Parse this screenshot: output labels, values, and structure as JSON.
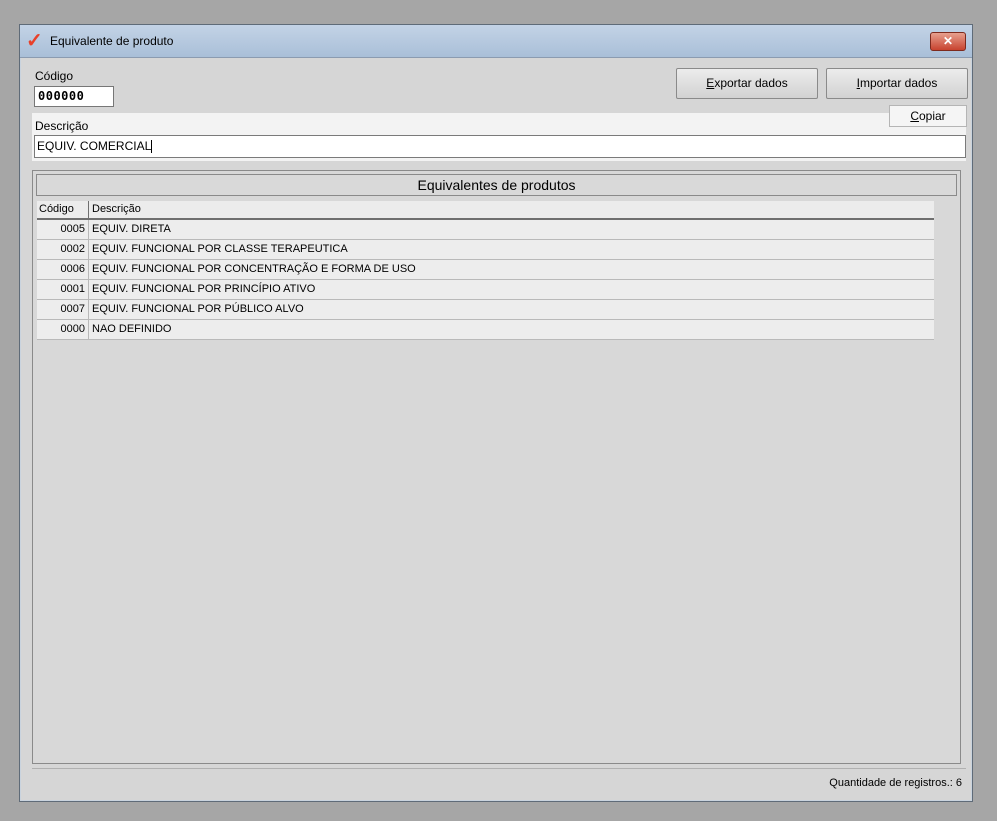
{
  "window": {
    "title": "Equivalente de produto",
    "close_label": "✕"
  },
  "form": {
    "code_label": "Código",
    "code_value": "000000",
    "description_label": "Descrição",
    "description_value": "EQUIV. COMERCIAL"
  },
  "toolbar": {
    "export_label_first": "E",
    "export_label_rest": "xportar dados",
    "import_label_first": "I",
    "import_label_rest": "mportar dados",
    "copy_label_first": "C",
    "copy_label_rest": "opiar"
  },
  "group": {
    "title": "Equivalentes de produtos"
  },
  "table": {
    "columns": [
      "Código",
      "Descrição"
    ],
    "rows": [
      {
        "code": "0005",
        "desc": "EQUIV.  DIRETA"
      },
      {
        "code": "0002",
        "desc": "EQUIV. FUNCIONAL POR CLASSE TERAPEUTICA"
      },
      {
        "code": "0006",
        "desc": "EQUIV. FUNCIONAL POR CONCENTRAÇÃO E FORMA DE USO"
      },
      {
        "code": "0001",
        "desc": "EQUIV. FUNCIONAL POR PRINCÍPIO ATIVO"
      },
      {
        "code": "0007",
        "desc": "EQUIV. FUNCIONAL POR PÚBLICO ALVO"
      },
      {
        "code": "0000",
        "desc": "NAO DEFINIDO"
      }
    ]
  },
  "status": {
    "record_count_text": "Quantidade de registros.: 6"
  },
  "colors": {
    "window_bg": "#d6d6d6",
    "titlebar": "#b6c8df",
    "close_button": "#c8432f",
    "app_icon": "#e8402a"
  },
  "icons": {
    "app": "checkmark-icon",
    "close": "close-icon"
  }
}
